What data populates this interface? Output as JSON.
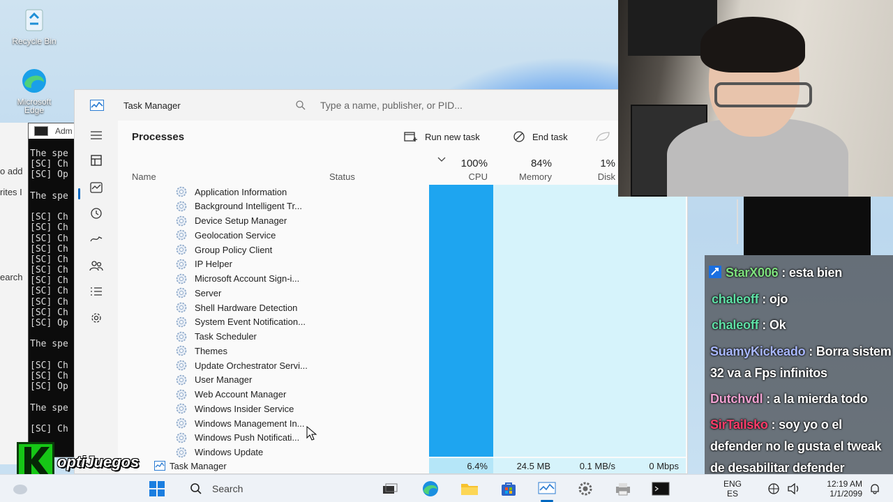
{
  "desktop": {
    "icons": [
      {
        "label": "Recycle Bin"
      },
      {
        "label": "Microsoft Edge"
      }
    ],
    "left_sliver": [
      "o add",
      "rites I",
      "earch"
    ]
  },
  "cmd": {
    "title": "Adm",
    "lines": [
      "The spe",
      "[SC] Ch",
      "[SC] Op",
      "",
      "The spe",
      "",
      "[SC] Ch",
      "[SC] Ch",
      "[SC] Ch",
      "[SC] Ch",
      "[SC] Ch",
      "[SC] Ch",
      "[SC] Ch",
      "[SC] Ch",
      "[SC] Ch",
      "[SC] Ch",
      "[SC] Op",
      "",
      "The spe",
      "",
      "[SC] Ch",
      "[SC] Ch",
      "[SC] Op",
      "",
      "The spe",
      "",
      "[SC] Ch"
    ]
  },
  "task_manager": {
    "title": "Task Manager",
    "search_placeholder": "Type a name, publisher, or PID...",
    "heading": "Processes",
    "run_new_task": "Run new task",
    "end_task": "End task",
    "columns": {
      "name": "Name",
      "status": "Status",
      "cpu_pct": "100%",
      "cpu": "CPU",
      "mem_pct": "84%",
      "mem": "Memory",
      "disk_pct": "1%",
      "disk": "Disk"
    },
    "processes": [
      "Application Information",
      "Background Intelligent Tr...",
      "Device Setup Manager",
      "Geolocation Service",
      "Group Policy Client",
      "IP Helper",
      "Microsoft Account Sign-i...",
      "Server",
      "Shell Hardware Detection",
      "System Event Notification...",
      "Task Scheduler",
      "Themes",
      "Update Orchestrator Servi...",
      "User Manager",
      "Web Account Manager",
      "Windows Insider Service",
      "Windows Management In...",
      "Windows Push Notificati...",
      "Windows Update"
    ],
    "bottom_row": {
      "name": "Task Manager",
      "cpu": "6.4%",
      "memory": "24.5 MB",
      "disk": "0.1 MB/s",
      "network": "0 Mbps"
    }
  },
  "chat": [
    {
      "user": "StarX006",
      "text": " : esta bien",
      "color": "#7ee07e",
      "badge": true
    },
    {
      "user": "chaleoff",
      "text": " : ojo",
      "color": "#5fe0a6"
    },
    {
      "user": "chaleoff",
      "text": " : Ok",
      "color": "#5fe0a6"
    },
    {
      "user": "SuamyKickeado",
      "text": " : Borra sistem 32 va a Fps infinitos",
      "color": "#a9b8ff"
    },
    {
      "user": "Dutchvdl",
      "text": " : a la mierda todo",
      "color": "#f0a0d0"
    },
    {
      "user": "SirTailsko",
      "text": " : soy yo o el defender no le gusta el tweak de desabilitar defender",
      "color": "#ff3c6a"
    }
  ],
  "logo": {
    "text": "optiJuegos"
  },
  "taskbar": {
    "search_label": "Search",
    "lang_top": "ENG",
    "lang_bottom": "ES",
    "time": "12:19 AM",
    "date": "1/1/2099"
  },
  "colors": {
    "cpu_fill": "#1ea5f0",
    "mem_fill": "#d6f3fb",
    "accent": "#0067c0"
  }
}
